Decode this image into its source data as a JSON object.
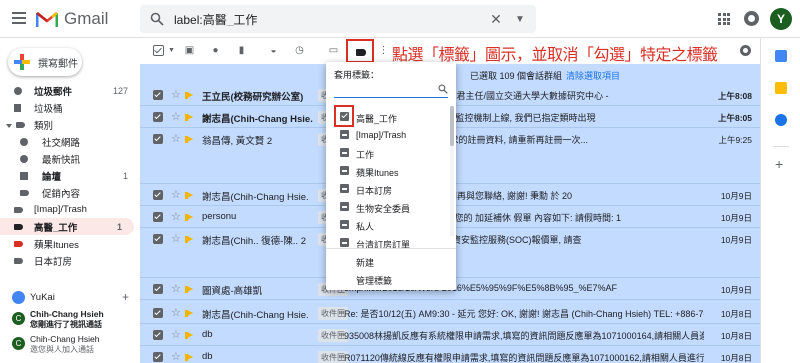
{
  "header": {
    "app_name": "Gmail",
    "search_value": "label:高醫_工作",
    "avatar_letter": "Y"
  },
  "sidebar": {
    "compose_label": "撰寫郵件",
    "items": [
      {
        "label": "垃圾郵件",
        "count": "127"
      },
      {
        "label": "垃圾桶",
        "count": ""
      },
      {
        "label": "類別",
        "count": ""
      },
      {
        "label": "社交網路",
        "count": ""
      },
      {
        "label": "最新快訊",
        "count": ""
      },
      {
        "label": "論壇",
        "count": "1"
      },
      {
        "label": "促銷內容",
        "count": ""
      },
      {
        "label": "[Imap]/Trash",
        "count": ""
      },
      {
        "label": "高醫_工作",
        "count": "1"
      },
      {
        "label": "蘋果Itunes",
        "count": ""
      },
      {
        "label": "日本訂房",
        "count": ""
      }
    ],
    "hangout_user": "YuKai",
    "contacts": [
      {
        "initial": "C",
        "name": "Chih-Chang Hsieh",
        "message": "您剛進行了視訊通話"
      },
      {
        "initial": "C",
        "name": "Chih-Chang Hsieh",
        "message": "邀您與人加入通話"
      }
    ]
  },
  "toolbar": {
    "annotation": "點選「標籤」圖示，並取消「勾選」特定之標籤"
  },
  "banner": {
    "text": "已選取 109 個會話群組",
    "link": "清除選取項目"
  },
  "emails": [
    {
      "sender": "王立民(校務研究辦公室)",
      "tag": "收件匣",
      "subject": "1:00 勵學大樓視聽中心/王苑君主任/國立交通大學大數據研究中心 -",
      "date": "上午8:08",
      "read": false
    },
    {
      "sender": "謝志昌(Chih-Chang Hsie.",
      "tag": "收件匣",
      "subject": "上 5:54 號寫道了 - 後系統的監控機制上線, 我們已指定類時出現",
      "date": "上午8:05",
      "read": false
    },
    {
      "sender": "翁昌傳, 黃文賢 2",
      "tag": "收件匣",
      "subject": "問題 - 同學 您好: 已詢除要求的註冊資料, 請重新再註冊一次...",
      "date": "上午9:25",
      "read": true
    },
    {
      "sender": "謝志昌(Chih-Chang Hsie.",
      "tag": "收件匣",
      "subject": "我們先研究看看, 預計本週四再與您聯絡, 謝謝! 秉勳 於 20",
      "date": "10月9日",
      "read": true
    },
    {
      "sender": "personu",
      "tag": "收件匣",
      "subject": "享如下, 請查照 - 同學 您好: 您的 加延補休 假單 內容如下: 請假時間: 1",
      "date": "10月9日",
      "read": true
    },
    {
      "sender": "謝志昌(Chih.. 復德-陳.. 2",
      "tag": "收件匣",
      "subject": "一事 - 組長: 收信好! 附件為資安監控服務(SOC)報價單, 請查",
      "date": "10月9日",
      "read": true
    },
    {
      "sender": "圖資處-高雄凱",
      "tag": "收件匣",
      "subject": "emp/files/2018/10/Word-2016%E5%95%9F%E5%8B%95_%E7%AF",
      "date": "10月9日",
      "read": true
    },
    {
      "sender": "謝志昌(Chih-Chang Hsie.",
      "tag": "收件匣",
      "subject": "Re: 是否10/12(五) AM9:30 - 延元 您好: OK, 謝謝! 謝志昌 (Chih-Chang Hsieh) TEL: +886-7-",
      "date": "10月8日",
      "read": true
    },
    {
      "sender": "db",
      "tag": "收件匣",
      "subject": "935008林揚凱反應有系統權限申請需求,填寫的資訊問題反應單為1071000164,請相關人員進行了",
      "date": "10月8日",
      "read": true
    },
    {
      "sender": "db",
      "tag": "收件匣",
      "subject": "R071120傳統線反應有權限申請需求,填寫的資訊問題反應單為1071000162,請相關人員進行了",
      "date": "10月8日",
      "read": true
    }
  ],
  "label_menu": {
    "title": "套用標籤：",
    "search_placeholder": "",
    "items": [
      {
        "label": "高醫_工作",
        "state": "checked"
      },
      {
        "label": "[Imap]/Trash",
        "state": "unchecked"
      },
      {
        "label": "工作",
        "state": "unchecked"
      },
      {
        "label": "蘋果Itunes",
        "state": "unchecked"
      },
      {
        "label": "日本訂房",
        "state": "unchecked"
      },
      {
        "label": "生物安全委員",
        "state": "unchecked"
      },
      {
        "label": "私人",
        "state": "unchecked"
      },
      {
        "label": "台清訂房訂單",
        "state": "unchecked"
      }
    ],
    "actions": [
      "新建",
      "管理標籤"
    ]
  },
  "colors": {
    "selected_row": "#c2dbff",
    "accent_red": "#d93025",
    "important": "#f4b400"
  }
}
